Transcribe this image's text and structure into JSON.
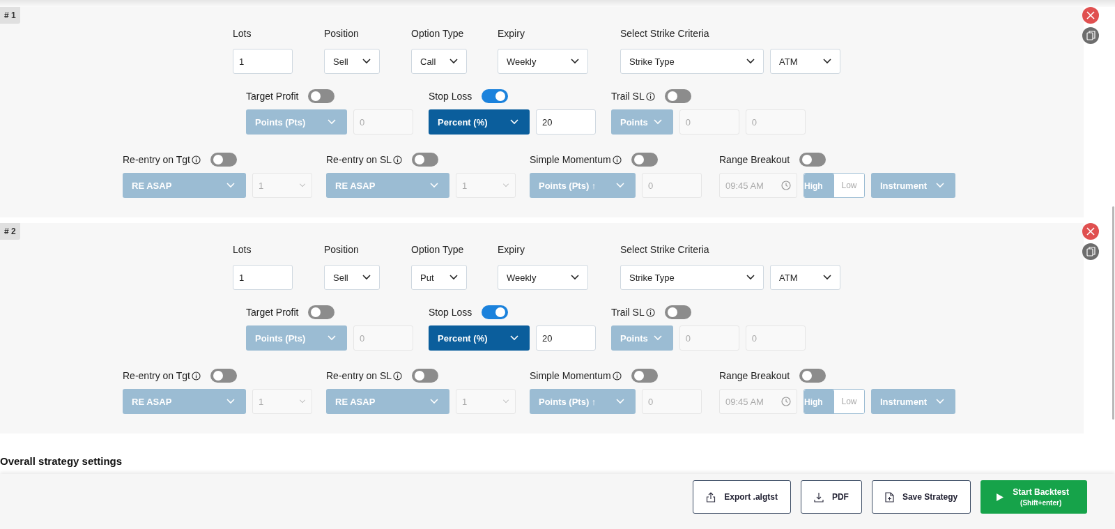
{
  "legs": [
    {
      "badge": "# 1",
      "basics": [
        {
          "label": "Lots",
          "kind": "input",
          "value": "1"
        },
        {
          "label": "Position",
          "kind": "select",
          "value": "Sell"
        },
        {
          "label": "Option Type",
          "kind": "select",
          "value": "Call"
        },
        {
          "label": "Expiry",
          "kind": "select",
          "value": "Weekly"
        },
        {
          "label": "Select Strike Criteria",
          "kind": "double",
          "values": [
            "Strike Type",
            "ATM"
          ]
        }
      ],
      "exits": [
        {
          "label": "Target Profit",
          "info": false,
          "on": false,
          "select": "Points (Pts)",
          "inputs": [
            "0"
          ]
        },
        {
          "label": "Stop Loss",
          "info": false,
          "on": true,
          "select": "Percent (%)",
          "inputs": [
            "20"
          ]
        },
        {
          "label": "Trail SL",
          "info": true,
          "on": false,
          "select": "Points",
          "inputs": [
            "0",
            "0"
          ]
        }
      ],
      "advanced": [
        {
          "kind": "reentry",
          "label": "Re-entry on Tgt",
          "info": true,
          "on": false,
          "select": "RE ASAP",
          "extra": "1"
        },
        {
          "kind": "reentry",
          "label": "Re-entry on SL",
          "info": true,
          "on": false,
          "select": "RE ASAP",
          "extra": "1"
        },
        {
          "kind": "momentum",
          "label": "Simple Momentum",
          "info": true,
          "on": false,
          "select": "Points (Pts) ↑",
          "extra": "0"
        },
        {
          "kind": "range",
          "label": "Range Breakout",
          "info": false,
          "on": false,
          "time": "09:45 AM",
          "sides": [
            {
              "label": "High",
              "selected": true
            },
            {
              "label": "Low",
              "selected": false
            }
          ],
          "select": "Instrument"
        }
      ]
    },
    {
      "badge": "# 2",
      "basics": [
        {
          "label": "Lots",
          "kind": "input",
          "value": "1"
        },
        {
          "label": "Position",
          "kind": "select",
          "value": "Sell"
        },
        {
          "label": "Option Type",
          "kind": "select",
          "value": "Put"
        },
        {
          "label": "Expiry",
          "kind": "select",
          "value": "Weekly"
        },
        {
          "label": "Select Strike Criteria",
          "kind": "double",
          "values": [
            "Strike Type",
            "ATM"
          ]
        }
      ],
      "exits": [
        {
          "label": "Target Profit",
          "info": false,
          "on": false,
          "select": "Points (Pts)",
          "inputs": [
            "0"
          ]
        },
        {
          "label": "Stop Loss",
          "info": false,
          "on": true,
          "select": "Percent (%)",
          "inputs": [
            "20"
          ]
        },
        {
          "label": "Trail SL",
          "info": true,
          "on": false,
          "select": "Points",
          "inputs": [
            "0",
            "0"
          ]
        }
      ],
      "advanced": [
        {
          "kind": "reentry",
          "label": "Re-entry on Tgt",
          "info": true,
          "on": false,
          "select": "RE ASAP",
          "extra": "1"
        },
        {
          "kind": "reentry",
          "label": "Re-entry on SL",
          "info": true,
          "on": false,
          "select": "RE ASAP",
          "extra": "1"
        },
        {
          "kind": "momentum",
          "label": "Simple Momentum",
          "info": true,
          "on": false,
          "select": "Points (Pts) ↑",
          "extra": "0"
        },
        {
          "kind": "range",
          "label": "Range Breakout",
          "info": false,
          "on": false,
          "time": "09:45 AM",
          "sides": [
            {
              "label": "High",
              "selected": true
            },
            {
              "label": "Low",
              "selected": false
            }
          ],
          "select": "Instrument"
        }
      ]
    }
  ],
  "overall_heading": "Overall strategy settings",
  "actions": [
    {
      "kind": "export",
      "label": "Export .algtst"
    },
    {
      "kind": "pdf",
      "label": "PDF"
    },
    {
      "kind": "save",
      "label": "Save Strategy"
    },
    {
      "kind": "start",
      "label": "Start Backtest",
      "sub": "(Shift+enter)"
    }
  ]
}
